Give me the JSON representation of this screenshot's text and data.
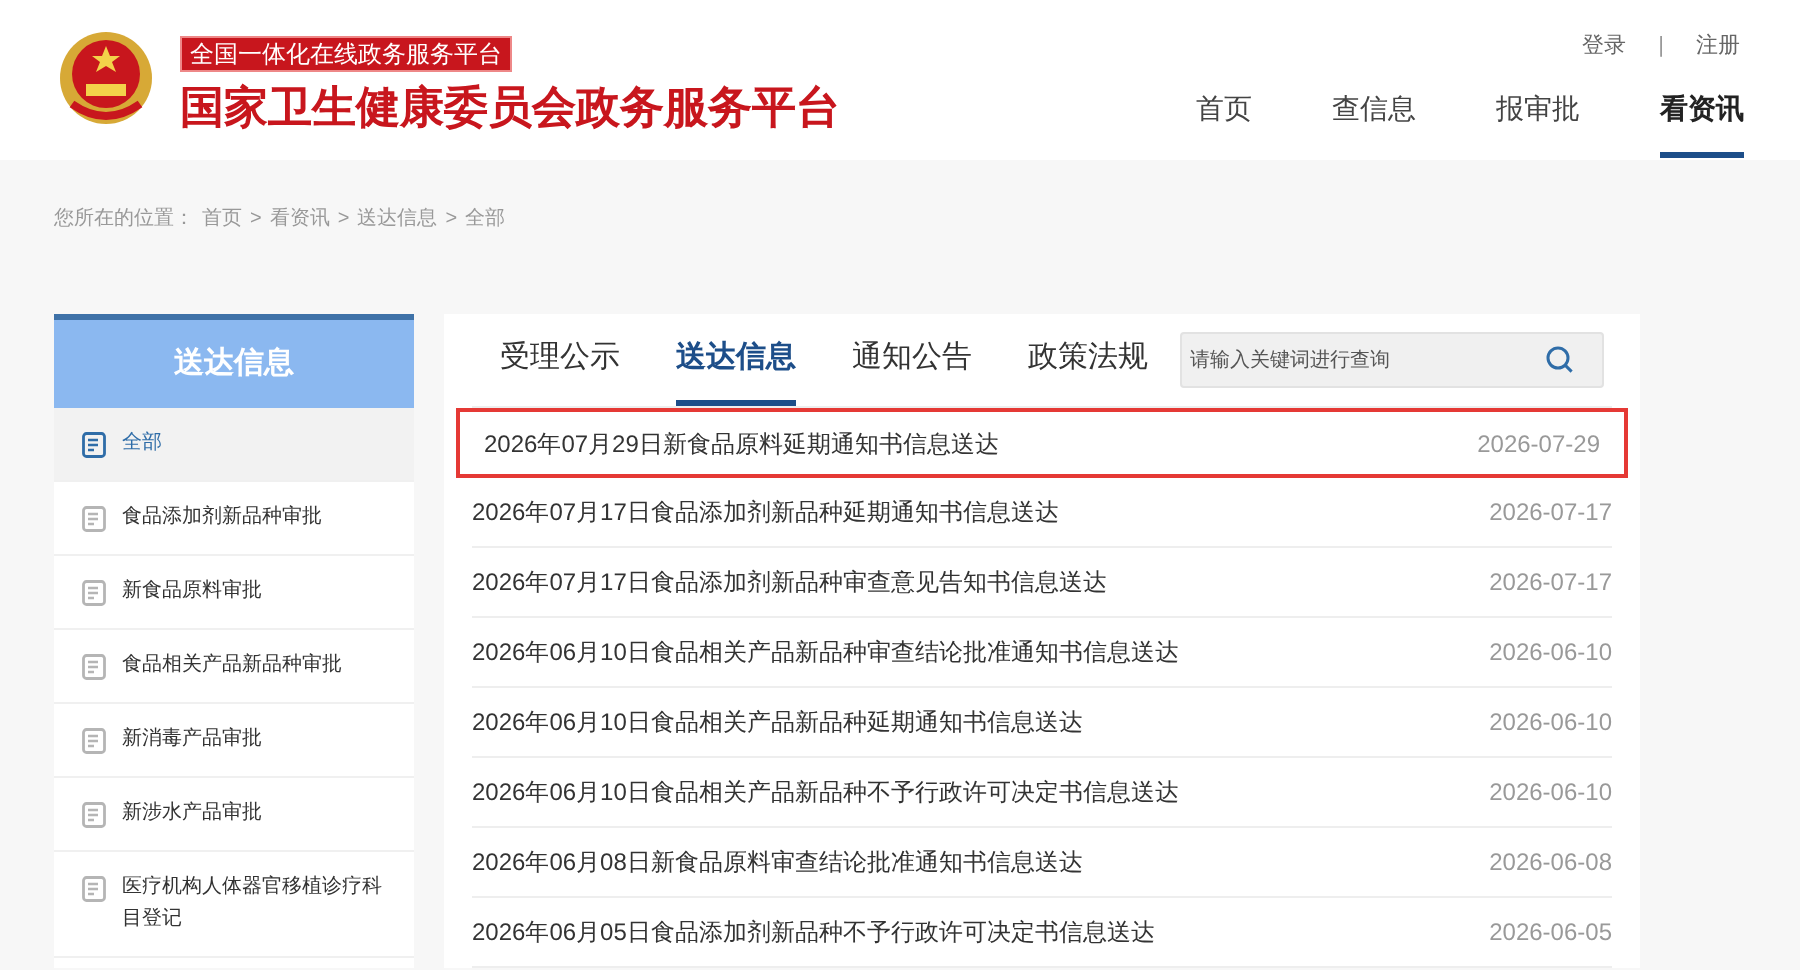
{
  "header": {
    "badge": "全国一体化在线政务服务平台",
    "title": "国家卫生健康委员会政务服务平台",
    "account_links": [
      {
        "label": "登录"
      },
      {
        "label": "注册"
      }
    ],
    "separator": "|",
    "nav": [
      {
        "label": "首页",
        "selected": false
      },
      {
        "label": "查信息",
        "selected": false
      },
      {
        "label": "报审批",
        "selected": false
      },
      {
        "label": "看资讯",
        "selected": true
      }
    ]
  },
  "breadcrumb": {
    "prefix": "您所在的位置：",
    "items": [
      "首页",
      "看资讯",
      "送达信息",
      "全部"
    ],
    "separator": ">"
  },
  "sidebar": {
    "title": "送达信息",
    "items": [
      {
        "label": "全部",
        "selected": true
      },
      {
        "label": "食品添加剂新品种审批",
        "selected": false
      },
      {
        "label": "新食品原料审批",
        "selected": false
      },
      {
        "label": "食品相关产品新品种审批",
        "selected": false
      },
      {
        "label": "新消毒产品审批",
        "selected": false
      },
      {
        "label": "新涉水产品审批",
        "selected": false
      },
      {
        "label": "医疗机构人体器官移植诊疗科目登记",
        "selected": false
      }
    ]
  },
  "tabs": [
    {
      "label": "受理公示",
      "selected": false
    },
    {
      "label": "送达信息",
      "selected": true
    },
    {
      "label": "通知公告",
      "selected": false
    },
    {
      "label": "政策法规",
      "selected": false
    }
  ],
  "search": {
    "placeholder": "请输入关键词进行查询"
  },
  "rows": [
    {
      "title": "2026年07月29日新食品原料延期通知书信息送达",
      "date": "2026-07-29",
      "highlighted": true
    },
    {
      "title": "2026年07月17日食品添加剂新品种延期通知书信息送达",
      "date": "2026-07-17",
      "highlighted": false
    },
    {
      "title": "2026年07月17日食品添加剂新品种审查意见告知书信息送达",
      "date": "2026-07-17",
      "highlighted": false
    },
    {
      "title": "2026年06月10日食品相关产品新品种审查结论批准通知书信息送达",
      "date": "2026-06-10",
      "highlighted": false
    },
    {
      "title": "2026年06月10日食品相关产品新品种延期通知书信息送达",
      "date": "2026-06-10",
      "highlighted": false
    },
    {
      "title": "2026年06月10日食品相关产品新品种不予行政许可决定书信息送达",
      "date": "2026-06-10",
      "highlighted": false
    },
    {
      "title": "2026年06月08日新食品原料审查结论批准通知书信息送达",
      "date": "2026-06-08",
      "highlighted": false
    },
    {
      "title": "2026年06月05日食品添加剂新品种不予行政许可决定书信息送达",
      "date": "2026-06-05",
      "highlighted": false
    }
  ]
}
